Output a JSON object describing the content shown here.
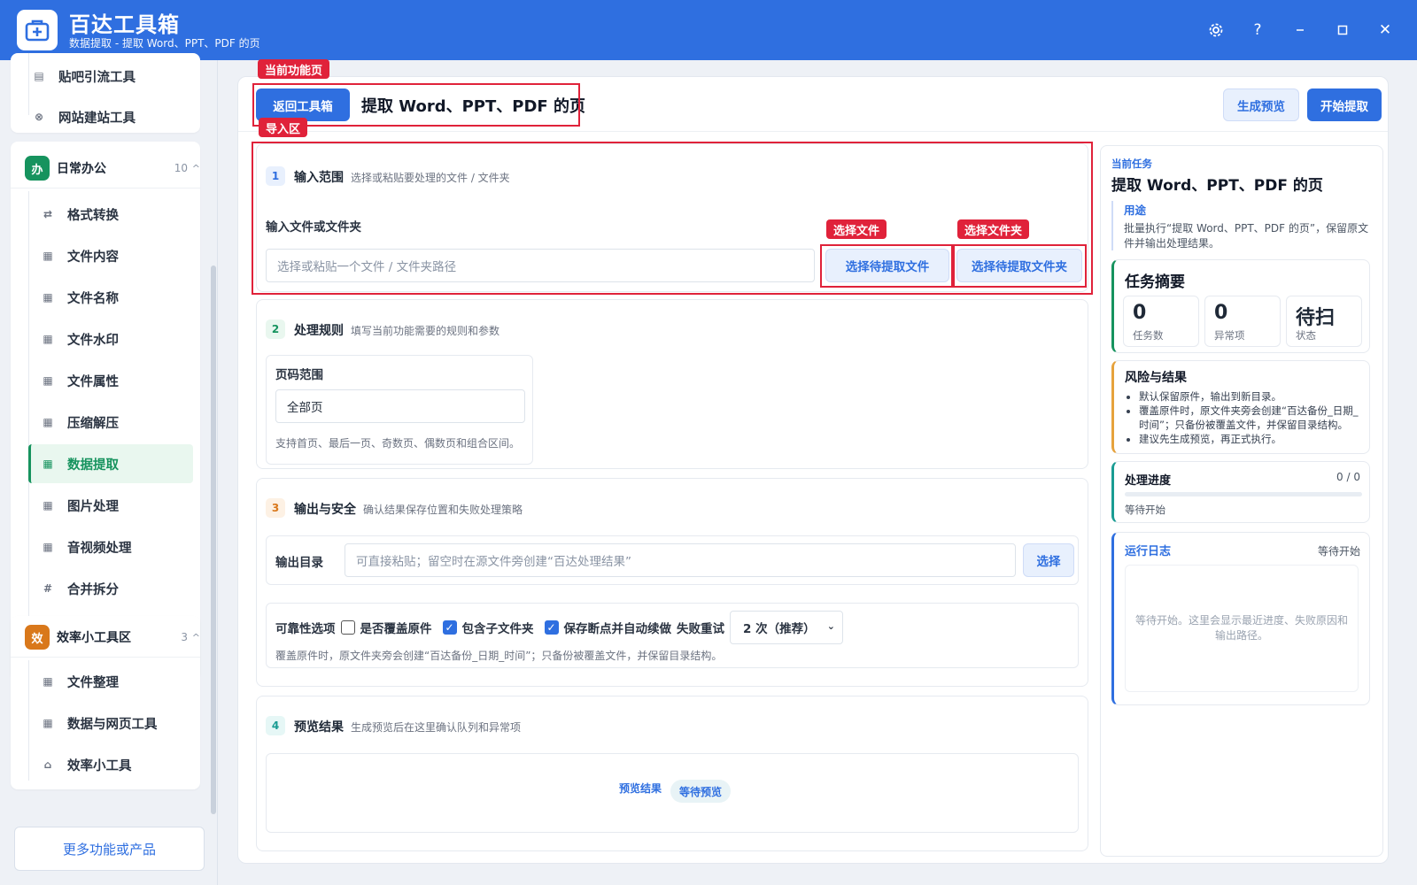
{
  "titlebar": {
    "title": "百达工具箱",
    "subtitle": "数据提取 - 提取 Word、PPT、PDF 的页",
    "icons": [
      "gear-icon",
      "help-icon",
      "minimize-icon",
      "maximize-icon",
      "close-icon"
    ]
  },
  "sidebar": {
    "top_items": [
      {
        "label": "贴吧引流工具",
        "icon": "doc-icon"
      },
      {
        "label": "网站建站工具",
        "icon": "globe-icon"
      }
    ],
    "group_office": {
      "badge": "办",
      "title": "日常办公",
      "count": "10",
      "color": "#16935e",
      "items": [
        {
          "label": "格式转换",
          "icon": "swap-icon"
        },
        {
          "label": "文件内容",
          "icon": "grid-icon"
        },
        {
          "label": "文件名称",
          "icon": "grid-icon"
        },
        {
          "label": "文件水印",
          "icon": "grid-icon"
        },
        {
          "label": "文件属性",
          "icon": "grid-icon"
        },
        {
          "label": "压缩解压",
          "icon": "grid-icon"
        },
        {
          "label": "数据提取",
          "icon": "grid-icon",
          "active": true
        },
        {
          "label": "图片处理",
          "icon": "grid-icon"
        },
        {
          "label": "音视频处理",
          "icon": "grid-icon"
        },
        {
          "label": "合并拆分",
          "icon": "hash-icon"
        }
      ]
    },
    "group_efficiency": {
      "badge": "效",
      "title": "效率小工具区",
      "count": "3",
      "color": "#d9781b",
      "items": [
        {
          "label": "文件整理",
          "icon": "grid-icon"
        },
        {
          "label": "数据与网页工具",
          "icon": "grid-icon"
        },
        {
          "label": "效率小工具",
          "icon": "box-icon"
        }
      ]
    },
    "more_label": "更多功能或产品"
  },
  "annotations": {
    "current_page": "当前功能页",
    "import_area": "导入区",
    "select_file": "选择文件",
    "select_folder": "选择文件夹"
  },
  "header": {
    "back_label": "返回工具箱",
    "page_title": "提取 Word、PPT、PDF 的页",
    "preview_label": "生成预览",
    "start_label": "开始提取"
  },
  "step1": {
    "num": "1",
    "title": "输入范围",
    "desc": "选择或粘贴要处理的文件 / 文件夹",
    "field_label": "输入文件或文件夹",
    "placeholder": "选择或粘贴一个文件 / 文件夹路径",
    "pick_file_label": "选择待提取文件",
    "pick_folder_label": "选择待提取文件夹"
  },
  "step2": {
    "num": "2",
    "title": "处理规则",
    "desc": "填写当前功能需要的规则和参数",
    "range_label": "页码范围",
    "range_value": "全部页",
    "range_hint": "支持首页、最后一页、奇数页、偶数页和组合区间。"
  },
  "step3": {
    "num": "3",
    "title": "输出与安全",
    "desc": "确认结果保存位置和失败处理策略",
    "out_label": "输出目录",
    "out_placeholder": "可直接粘贴；留空时在源文件旁创建“百达处理结果”",
    "choose_label": "选择",
    "reliability_label": "可靠性选项",
    "opt_overwrite": "是否覆盖原件",
    "opt_overwrite_checked": false,
    "opt_subfolders": "包含子文件夹",
    "opt_subfolders_checked": true,
    "opt_resume": "保存断点并自动续做",
    "opt_resume_checked": true,
    "retry_label": "失败重试",
    "retry_value": "2 次（推荐）",
    "note": "覆盖原件时，原文件夹旁会创建“百达备份_日期_时间”；只备份被覆盖文件，并保留目录结构。"
  },
  "step4": {
    "num": "4",
    "title": "预览结果",
    "desc": "生成预览后在这里确认队列和异常项",
    "preview_label": "预览结果",
    "badge": "等待预览"
  },
  "right": {
    "task_label": "当前任务",
    "task_title": "提取 Word、PPT、PDF 的页",
    "usage_label": "用途",
    "usage_text": "批量执行“提取 Word、PPT、PDF 的页”，保留原文件并输出处理结果。",
    "summary_title": "任务摘要",
    "stats": [
      {
        "value": "0",
        "label": "任务数"
      },
      {
        "value": "0",
        "label": "异常项"
      },
      {
        "value": "待扫",
        "label": "状态"
      }
    ],
    "risk_title": "风险与结果",
    "risk_items": [
      "默认保留原件，输出到新目录。",
      "覆盖原件时，原文件夹旁会创建“百达备份_日期_时间”；只备份被覆盖文件，并保留目录结构。",
      "建议先生成预览，再正式执行。"
    ],
    "progress_title": "处理进度",
    "progress_count": "0 / 0",
    "progress_fraction": 0,
    "progress_status": "等待开始",
    "log_title": "运行日志",
    "log_status": "等待开始",
    "log_text": "等待开始。这里会显示最近进度、失败原因和输出路径。"
  }
}
